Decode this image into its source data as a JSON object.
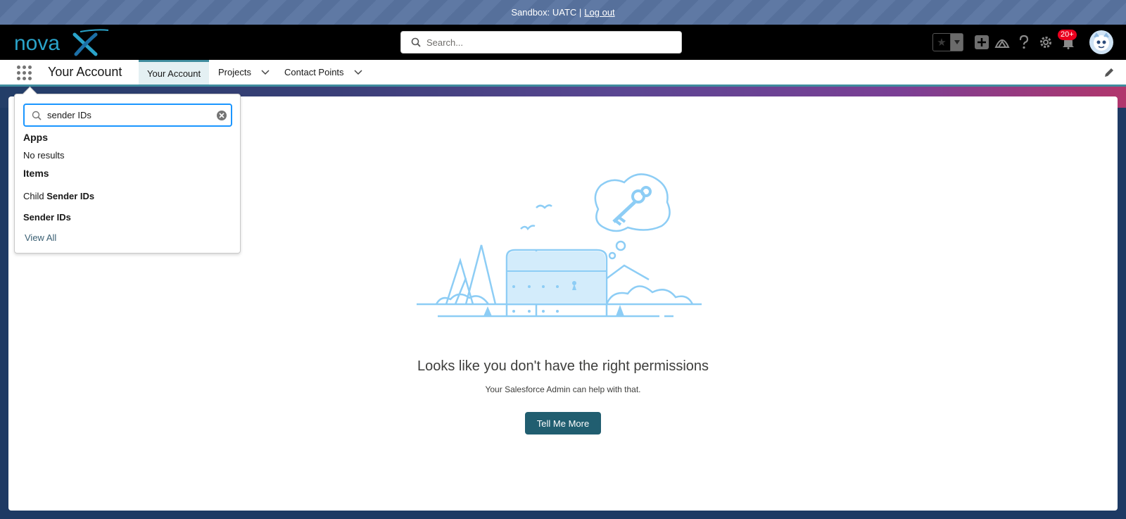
{
  "banner": {
    "text": "Sandbox: UATC |",
    "logout": "Log out"
  },
  "header": {
    "logo_text": "novaX",
    "search_placeholder": "Search...",
    "notification_count": "20+"
  },
  "nav": {
    "app_name": "Your Account",
    "tabs": [
      {
        "label": "Your Account"
      },
      {
        "label": "Projects"
      },
      {
        "label": "Contact Points"
      }
    ]
  },
  "launcher": {
    "search_value": "sender IDs",
    "apps_heading": "Apps",
    "apps_empty": "No results",
    "items_heading": "Items",
    "results": [
      {
        "prefix": "Child ",
        "match": "Sender IDs"
      },
      {
        "prefix": "",
        "match": "Sender IDs"
      }
    ],
    "view_all": "View All"
  },
  "main": {
    "title": "Looks like you don't have the right permissions",
    "subtitle": "Your Salesforce Admin can help with that.",
    "button": "Tell Me More"
  },
  "colors": {
    "accent": "#215e70",
    "tab_active_bg": "#e4f0f3",
    "focus": "#1b96ff",
    "badge": "#ea001e",
    "illustration": "#8dcdf5"
  }
}
